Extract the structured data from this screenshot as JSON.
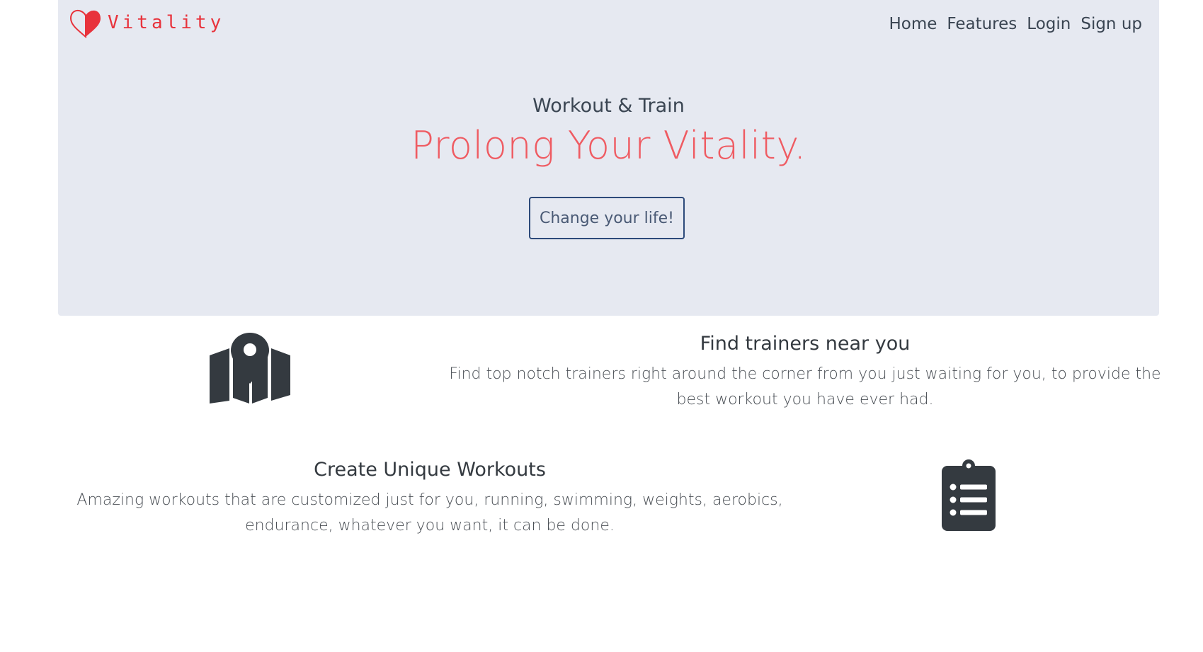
{
  "brand": {
    "name": "Vitality",
    "accent": "#e8333c"
  },
  "nav": {
    "items": [
      {
        "label": "Home"
      },
      {
        "label": "Features"
      },
      {
        "label": "Login"
      },
      {
        "label": "Sign up"
      }
    ]
  },
  "hero": {
    "subtitle": "Workout & Train",
    "title": "Prolong Your Vitality.",
    "button_label": "Change your life!",
    "title_color": "#ef5b62",
    "background": "#e6e9f1"
  },
  "features": [
    {
      "icon": "map-marker-icon",
      "title": "Find trainers near you",
      "description": "Find top notch trainers right around the corner from you just waiting for you, to provide the best workout you have ever had."
    },
    {
      "icon": "clipboard-list-icon",
      "title": "Create Unique Workouts",
      "description": "Amazing workouts that are customized just for you, running, swimming, weights, aerobics, endurance, whatever you want, it can be done."
    }
  ]
}
